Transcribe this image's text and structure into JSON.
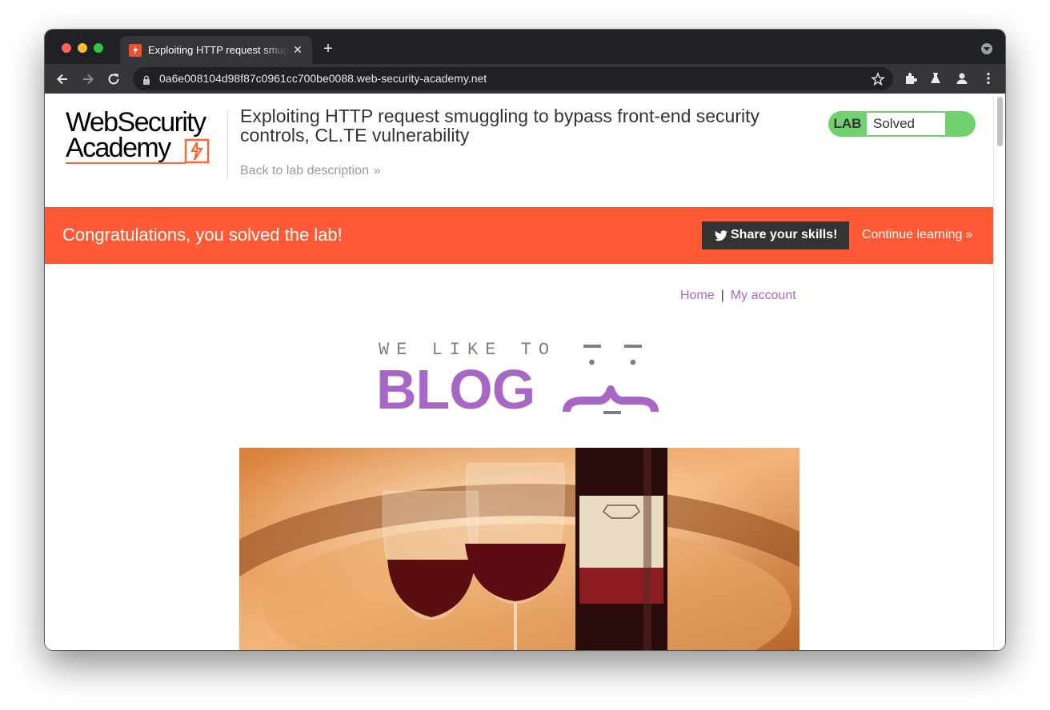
{
  "browser": {
    "tab_title": "Exploiting HTTP request smuggling to bypass front-end security controls, CL.TE vulnerability",
    "tab_close": "✕",
    "new_tab": "+",
    "url": "0a6e008104d98f87c0961cc700be0088.web-security-academy.net",
    "icons": [
      "back-arrow-icon",
      "forward-arrow-icon",
      "reload-icon",
      "lock-icon",
      "star-icon",
      "extensions-icon",
      "labs-flask-icon",
      "profile-icon",
      "kebab-menu-icon"
    ]
  },
  "lab_header": {
    "logo_line1": "WebSecurity",
    "logo_line2": "Academy",
    "title": "Exploiting HTTP request smuggling to bypass front-end security controls, CL.TE vulnerability",
    "back_link": "Back to lab description",
    "back_chevron": "»",
    "status_badge": "LAB",
    "status_text": "Solved",
    "status_color": "#70d16d"
  },
  "banner": {
    "message": "Congratulations, you solved the lab!",
    "share_button": "Share your skills!",
    "continue_link": "Continue learning",
    "continue_chevron": "»",
    "color": "#ff5a35"
  },
  "blog": {
    "nav": {
      "home": "Home",
      "separator": "|",
      "my_account": "My account"
    },
    "logo_small": "WE LIKE TO",
    "logo_big": "BLOG",
    "accent": "#a768c5"
  }
}
